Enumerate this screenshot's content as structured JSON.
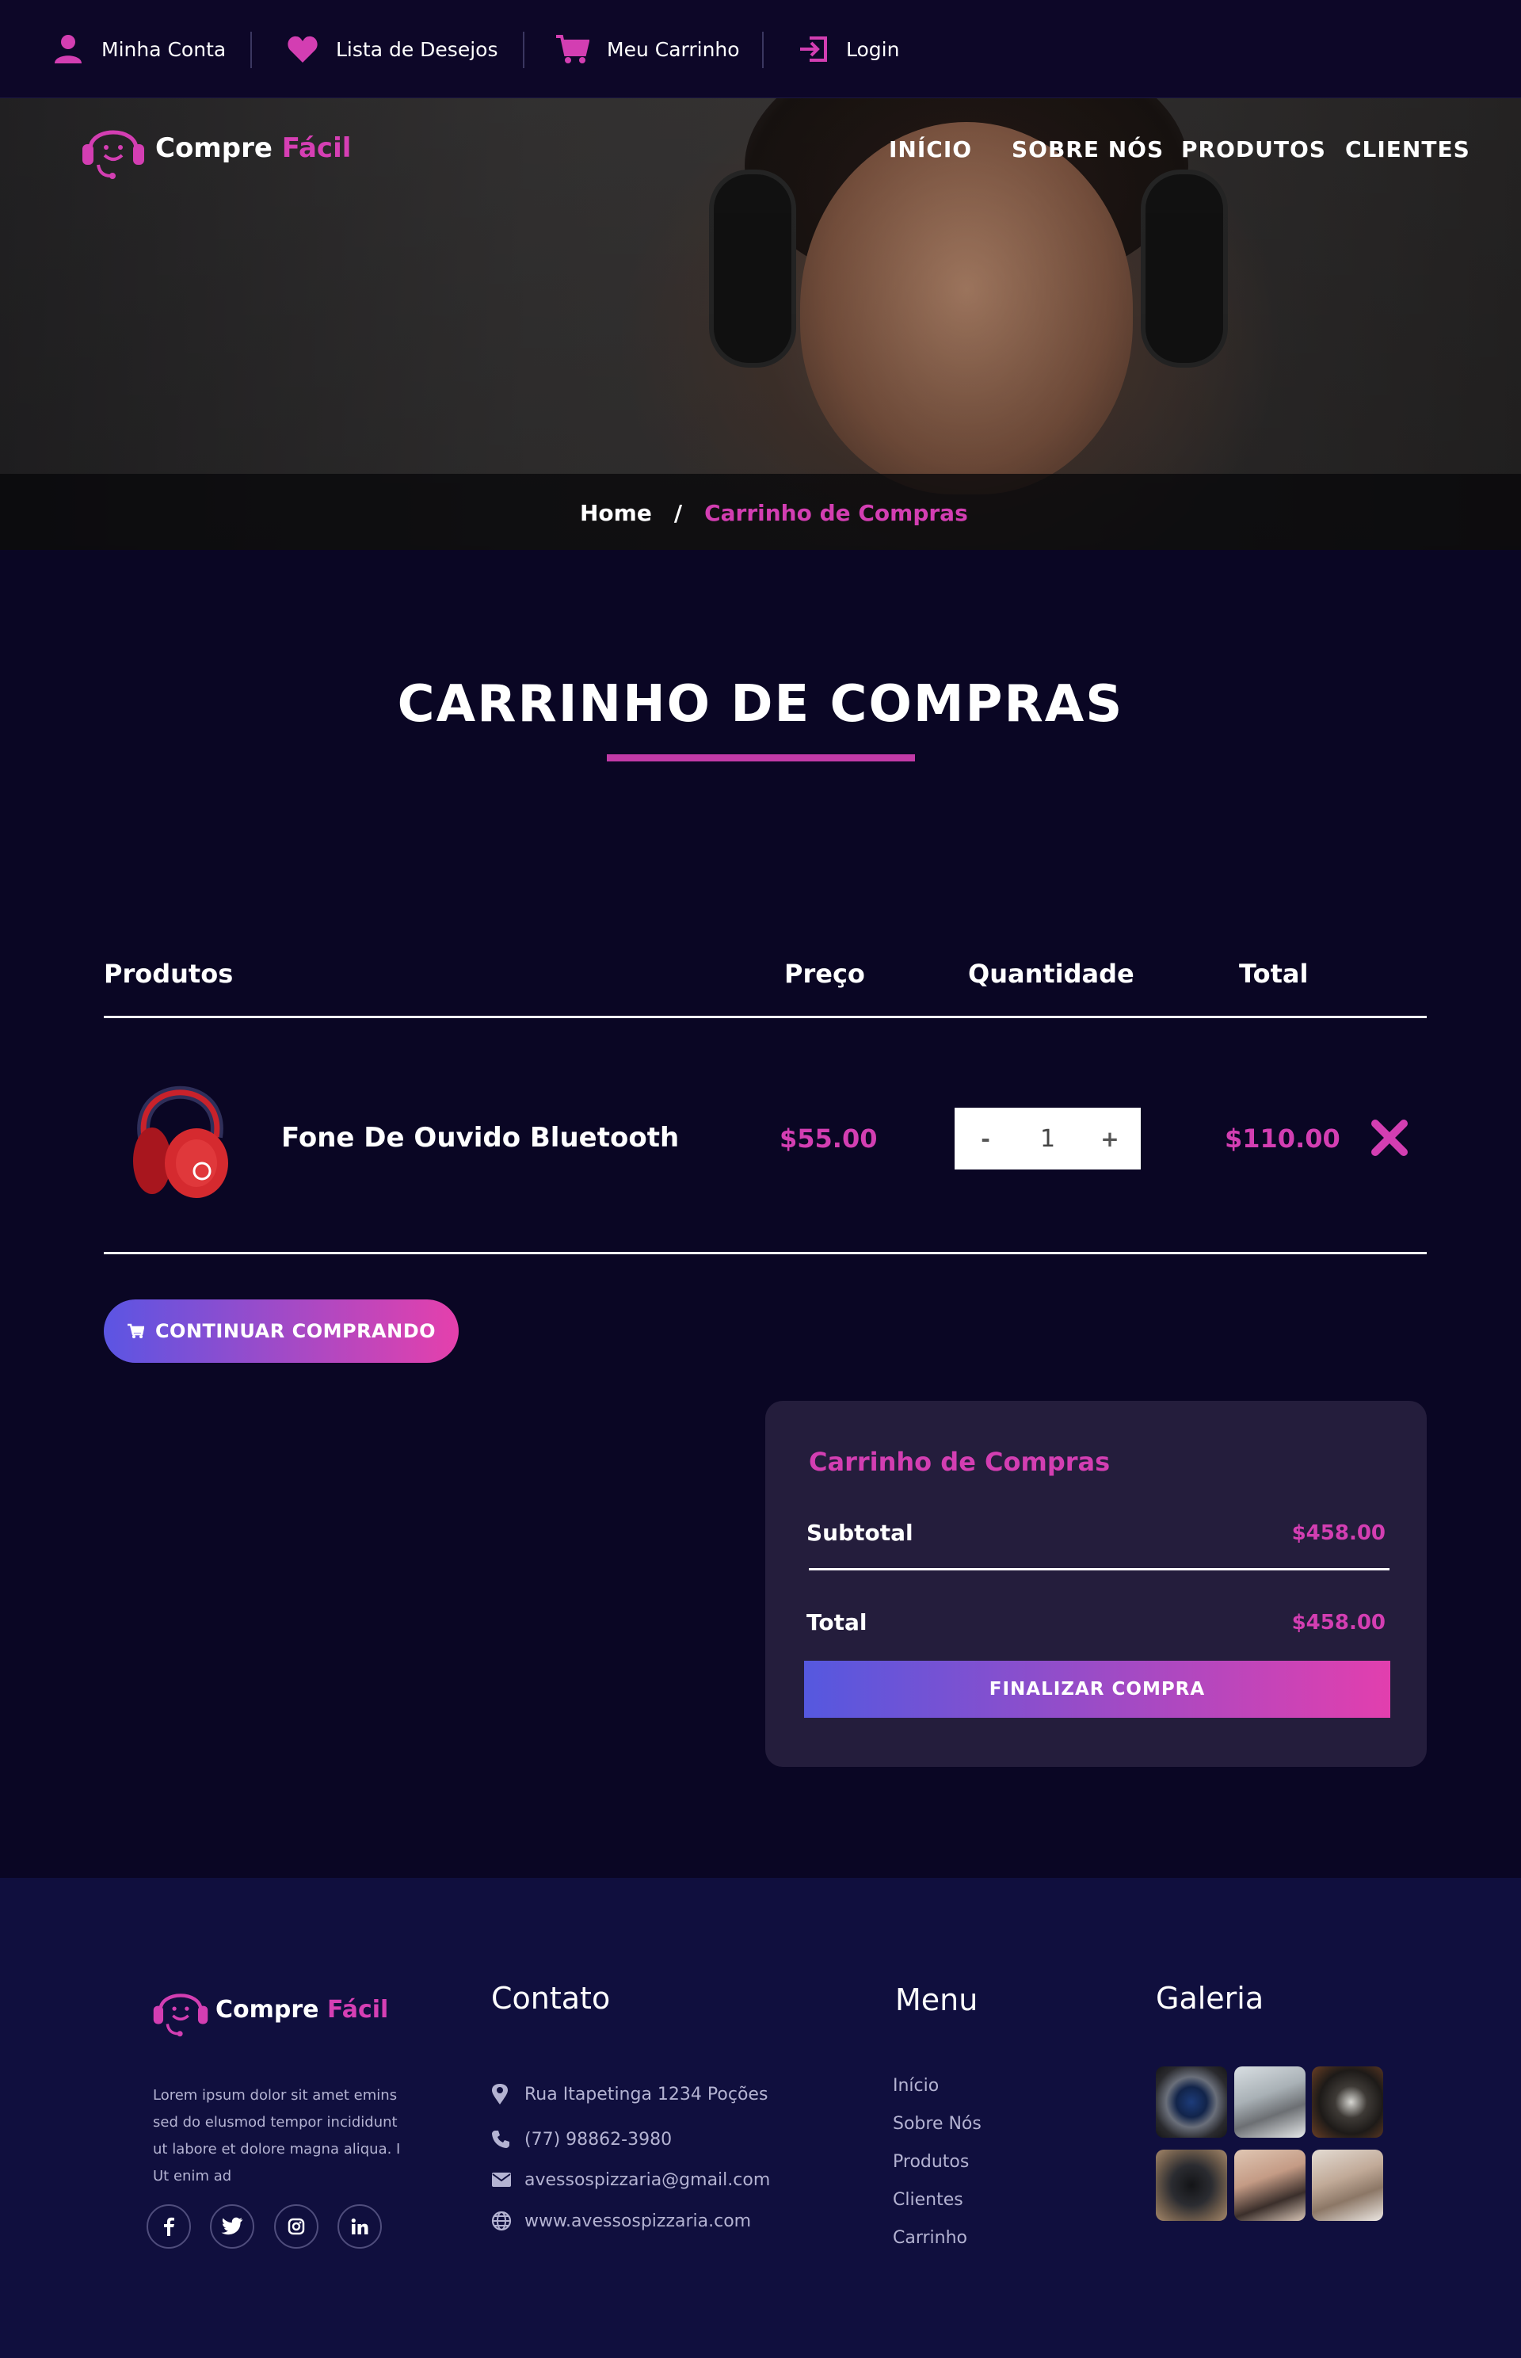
{
  "topbar": {
    "items": [
      {
        "label": "Minha Conta",
        "icon": "user-icon"
      },
      {
        "label": "Lista de Desejos",
        "icon": "heart-icon"
      },
      {
        "label": "Meu Carrinho",
        "icon": "cart-icon"
      },
      {
        "label": "Login",
        "icon": "login-icon"
      }
    ]
  },
  "brand": {
    "first": "Compre",
    "second": "Fácil",
    "logo_icon": "headset-smile-icon"
  },
  "nav": [
    "INÍCIO",
    "SOBRE NÓS",
    "PRODUTOS",
    "CLIENTES"
  ],
  "breadcrumb": {
    "home": "Home",
    "separator": "/",
    "current": "Carrinho de Compras"
  },
  "page_title": "CARRINHO DE COMPRAS",
  "table": {
    "headers": {
      "product": "Produtos",
      "price": "Preço",
      "quantity": "Quantidade",
      "total": "Total"
    },
    "rows": [
      {
        "name": "Fone De Ouvido Bluetooth",
        "price": "$55.00",
        "qty_minus": "-",
        "qty": "1",
        "qty_plus": "+",
        "total": "$110.00",
        "remove_icon": "close-x-icon"
      }
    ]
  },
  "continue_button": "CONTINUAR COMPRANDO",
  "summary": {
    "title": "Carrinho de Compras",
    "subtotal_label": "Subtotal",
    "subtotal_value": "$458.00",
    "total_label": "Total",
    "total_value": "$458.00",
    "finalize": "FINALIZAR COMPRA"
  },
  "footer": {
    "description": "Lorem ipsum dolor sit amet emins sed do elusmod tempor incididunt ut labore et dolore magna aliqua. I Ut enim ad",
    "social": [
      "facebook-icon",
      "twitter-icon",
      "instagram-icon",
      "linkedin-icon"
    ],
    "contact_title": "Contato",
    "contact": [
      {
        "icon": "map-pin-icon",
        "text": "Rua Itapetinga 1234 Poções"
      },
      {
        "icon": "phone-icon",
        "text": "(77) 98862-3980"
      },
      {
        "icon": "envelope-icon",
        "text": "avessospizzaria@gmail.com"
      },
      {
        "icon": "globe-icon",
        "text": "www.avessospizzaria.com"
      }
    ],
    "menu_title": "Menu",
    "menu": [
      "Início",
      "Sobre Nós",
      "Produtos",
      "Clientes",
      "Carrinho"
    ],
    "gallery_title": "Galeria"
  },
  "colors": {
    "accent": "#d33eb2",
    "background": "#0a0624",
    "footer": "#100f3e",
    "gradient_start": "#5b55e3",
    "gradient_end": "#e540ac"
  }
}
